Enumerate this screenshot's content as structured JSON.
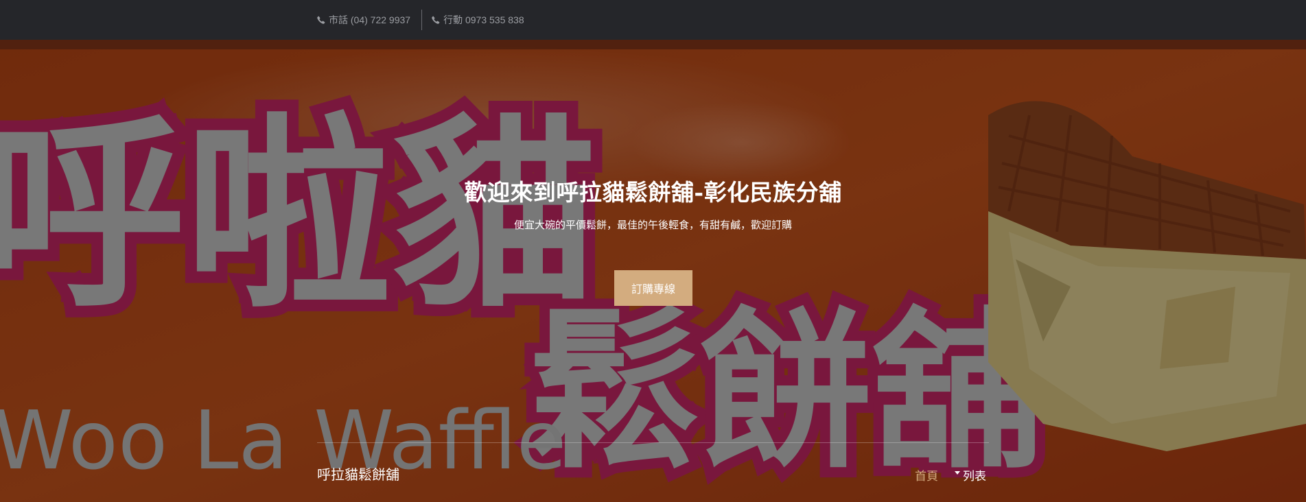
{
  "topbar": {
    "landline": "市話 (04) 722 9937",
    "mobile": "行動 0973 535 838",
    "phone_icon": "phone-icon"
  },
  "hero": {
    "title": "歡迎來到呼拉貓鬆餅舖-彰化民族分舖",
    "subtitle": "便宜大碗的平價鬆餅，最佳的午後輕食，有甜有鹹，歡迎訂購",
    "order_button": "訂購專線",
    "sign_text_1": "呼啦貓",
    "sign_text_2": "鬆餅舖",
    "sign_text_en": "Woo La Waffle"
  },
  "nav": {
    "brand": "呼拉貓鬆餅舖",
    "home": "首頁",
    "list": "列表"
  },
  "colors": {
    "topbar_bg": "#25262a",
    "accent": "#d3ac7f",
    "sign_orange": "#c9551c",
    "sign_magenta": "#d0286a"
  }
}
